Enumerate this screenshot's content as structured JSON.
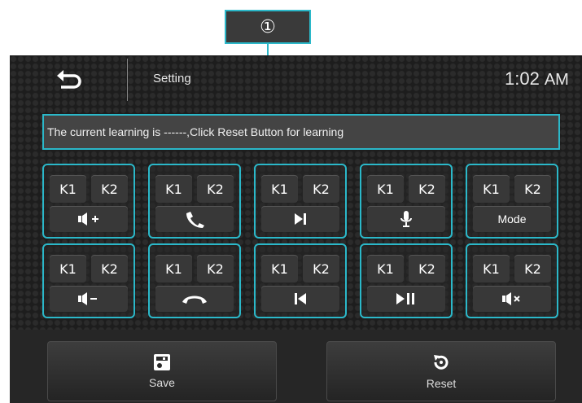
{
  "callout": {
    "marker": "①"
  },
  "header": {
    "title": "Setting",
    "time": "1:02",
    "ampm": "AM"
  },
  "info": {
    "message": "The current learning is ------,Click Reset Button for learning"
  },
  "key_labels": {
    "k1": "K1",
    "k2": "K2"
  },
  "buttons": [
    {
      "icon": "volume-up-icon"
    },
    {
      "icon": "phone-answer-icon"
    },
    {
      "icon": "next-track-icon"
    },
    {
      "icon": "microphone-icon"
    },
    {
      "label": "Mode"
    },
    {
      "icon": "volume-down-icon"
    },
    {
      "icon": "phone-hangup-icon"
    },
    {
      "icon": "previous-track-icon"
    },
    {
      "icon": "play-pause-icon"
    },
    {
      "icon": "mute-icon"
    }
  ],
  "footer": {
    "save_label": "Save",
    "reset_label": "Reset"
  },
  "colors": {
    "accent": "#2bb8c9",
    "background": "#1d1d1d",
    "button": "#383838",
    "text": "#ffffff"
  }
}
